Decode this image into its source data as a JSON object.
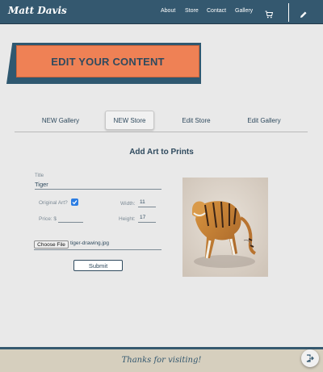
{
  "header": {
    "brand": "Matt Davis",
    "nav": [
      "About",
      "Store",
      "Contact",
      "Gallery"
    ],
    "icons": {
      "cart": "cart-icon",
      "edit": "pencil-icon"
    },
    "bar_color": "#34586f"
  },
  "banner": {
    "text": "EDIT YOUR CONTENT",
    "color": "#ef8155",
    "shadow_color": "#2f5870"
  },
  "tabs": [
    {
      "label": "NEW Gallery",
      "active": false
    },
    {
      "label": "NEW Store",
      "active": true
    },
    {
      "label": "Edit Store",
      "active": false
    },
    {
      "label": "Edit Gallery",
      "active": false
    }
  ],
  "form": {
    "title": "Add Art to Prints",
    "title_field": {
      "label": "Title",
      "value": "Tiger"
    },
    "original_art": {
      "label": "Original Art?",
      "checked": true
    },
    "width": {
      "label": "Width:",
      "value": "11"
    },
    "price": {
      "label": "Price: $",
      "value": ""
    },
    "height": {
      "label": "Height:",
      "value": "17"
    },
    "file": {
      "button_label": "Choose File",
      "file_name": "tiger-drawing.jpg"
    },
    "submit_label": "Submit"
  },
  "preview": {
    "image": "tiger-drawing-image"
  },
  "footer": {
    "text": "Thanks for visiting!",
    "logout_icon": "logout-icon"
  }
}
